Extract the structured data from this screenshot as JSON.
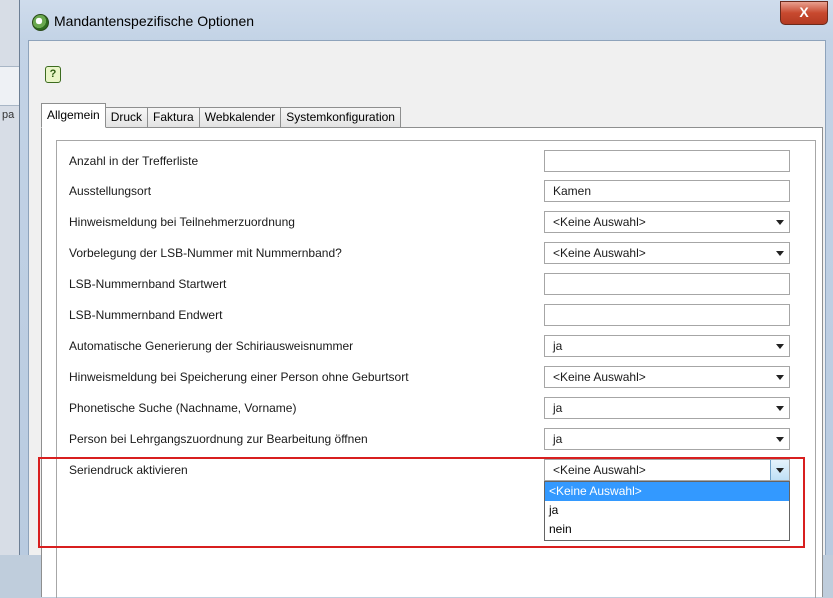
{
  "background": {
    "partial_text": "pa"
  },
  "window": {
    "title": "Mandantenspezifische Optionen",
    "close_label": "X"
  },
  "help": {
    "icon": "help-icon",
    "glyph": "?"
  },
  "tabs": [
    "Allgemein",
    "Druck",
    "Faktura",
    "Webkalender",
    "Systemkonfiguration"
  ],
  "active_tab": "Allgemein",
  "fields": [
    {
      "label": "Anzahl in der Trefferliste",
      "type": "text",
      "value": ""
    },
    {
      "label": "Ausstellungsort",
      "type": "text",
      "value": "Kamen"
    },
    {
      "label": "Hinweismeldung bei Teilnehmerzuordnung",
      "type": "select",
      "value": "<Keine Auswahl>"
    },
    {
      "label": "Vorbelegung der LSB-Nummer mit Nummernband?",
      "type": "select",
      "value": "<Keine Auswahl>"
    },
    {
      "label": "LSB-Nummernband Startwert",
      "type": "text",
      "value": ""
    },
    {
      "label": "LSB-Nummernband Endwert",
      "type": "text",
      "value": ""
    },
    {
      "label": "Automatische Generierung der Schiriausweisnummer",
      "type": "select",
      "value": "ja"
    },
    {
      "label": "Hinweismeldung bei Speicherung einer Person ohne Geburtsort",
      "type": "select",
      "value": "<Keine Auswahl>"
    },
    {
      "label": "Phonetische Suche (Nachname, Vorname)",
      "type": "select",
      "value": "ja"
    },
    {
      "label": "Person bei Lehrgangszuordnung zur Bearbeitung öffnen",
      "type": "select",
      "value": "ja"
    },
    {
      "label": "Seriendruck aktivieren",
      "type": "select",
      "value": "<Keine Auswahl>"
    }
  ],
  "open_dropdown": {
    "options": [
      "<Keine Auswahl>",
      "ja",
      "nein"
    ],
    "selected_index": 0
  },
  "colors": {
    "highlight_border": "#d81f1f",
    "selection": "#3399ff",
    "close_button": "#c8492f"
  }
}
